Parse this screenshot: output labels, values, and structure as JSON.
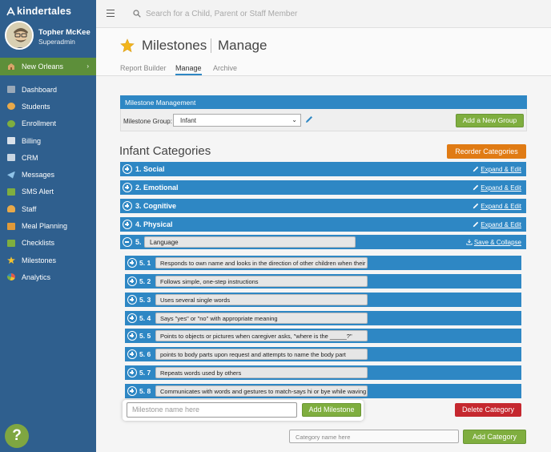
{
  "brand": {
    "name": "kindertales"
  },
  "profile": {
    "name": "Topher McKee",
    "role": "Superadmin"
  },
  "location": {
    "label": "New Orleans"
  },
  "nav": [
    {
      "label": "Dashboard",
      "icon": "dashboard-icon"
    },
    {
      "label": "Students",
      "icon": "students-icon"
    },
    {
      "label": "Enrollment",
      "icon": "enrollment-icon"
    },
    {
      "label": "Billing",
      "icon": "billing-icon"
    },
    {
      "label": "CRM",
      "icon": "crm-icon"
    },
    {
      "label": "Messages",
      "icon": "messages-icon"
    },
    {
      "label": "SMS Alert",
      "icon": "sms-icon"
    },
    {
      "label": "Staff",
      "icon": "staff-icon"
    },
    {
      "label": "Meal Planning",
      "icon": "meal-icon"
    },
    {
      "label": "Checklists",
      "icon": "checklist-icon"
    },
    {
      "label": "Milestones",
      "icon": "star-icon"
    },
    {
      "label": "Analytics",
      "icon": "analytics-icon"
    }
  ],
  "help": {
    "label": "?"
  },
  "search": {
    "placeholder": "Search for a Child, Parent or Staff Member"
  },
  "page": {
    "title": "Milestones",
    "subtitle": "Manage"
  },
  "tabs": [
    "Report Builder",
    "Manage",
    "Archive"
  ],
  "management": {
    "header": "Milestone Management",
    "group_label": "Milestone Group:",
    "group_value": "Infant",
    "add_group_label": "Add a New Group"
  },
  "categories_title": "Infant Categories",
  "reorder_label": "Reorder Categories",
  "expand_label": "Expand & Edit",
  "save_collapse_label": "Save & Collapse",
  "categories": [
    {
      "number": "1.",
      "name": "Social"
    },
    {
      "number": "2.",
      "name": "Emotional"
    },
    {
      "number": "3.",
      "name": "Cognitive"
    },
    {
      "number": "4.",
      "name": "Physical"
    },
    {
      "number": "5.",
      "name": "Language"
    }
  ],
  "milestones": [
    {
      "number": "5. 1",
      "text": "Responds to own name and looks in the direction of other children when their name"
    },
    {
      "number": "5. 2",
      "text": "Follows simple, one-step instructions"
    },
    {
      "number": "5. 3",
      "text": "Uses several single words"
    },
    {
      "number": "5. 4",
      "text": "Says \"yes\" or \"no\" with appropriate meaning"
    },
    {
      "number": "5. 5",
      "text": "Points to objects or pictures when caregiver asks, \"where is the _____?\""
    },
    {
      "number": "5. 6",
      "text": "points to body parts upon request and attempts to name the body part"
    },
    {
      "number": "5. 7",
      "text": "Repeats words used by others"
    },
    {
      "number": "5. 8",
      "text": "Communicates with words and gestures to match-says hi or bye while waving"
    }
  ],
  "milestone_input": {
    "placeholder": "Milestone name here"
  },
  "add_milestone_label": "Add Milestone",
  "delete_category_label": "Delete Category",
  "category_input": {
    "placeholder": "Category name here"
  },
  "add_category_label": "Add Category",
  "colors": {
    "sidebar": "#2f5f8e",
    "accent": "#2e87c4",
    "green": "#7fae3f",
    "orange": "#e07b14",
    "red": "#c5282f"
  }
}
